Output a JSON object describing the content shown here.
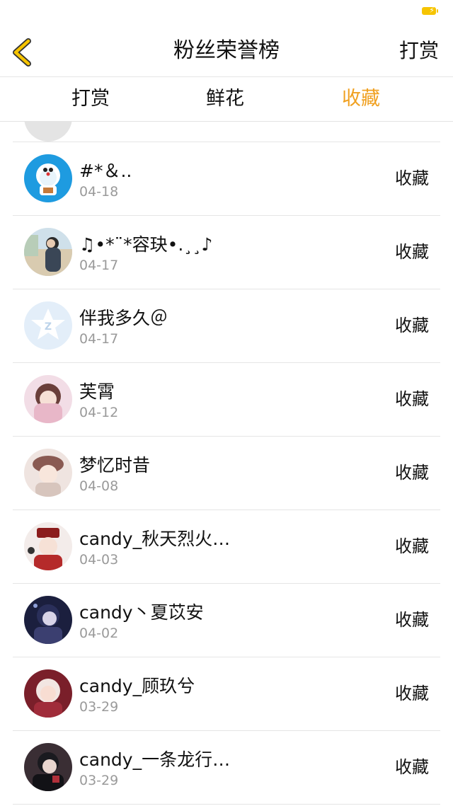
{
  "header": {
    "title": "粉丝荣誉榜",
    "action_label": "打赏"
  },
  "tabs": [
    {
      "label": "打赏"
    },
    {
      "label": "鲜花"
    },
    {
      "label": "收藏",
      "active": true
    }
  ],
  "colors": {
    "accent": "#f0a020",
    "back_icon": "#f6c400"
  },
  "fans": [
    {
      "name": "#*＆..",
      "date": "04-18",
      "action": "收藏",
      "avatar": "doraemon-avatar"
    },
    {
      "name": "♫•*¨*容玦•.¸¸♪",
      "date": "04-17",
      "action": "收藏",
      "avatar": "photo-avatar"
    },
    {
      "name": "伴我多久＠",
      "date": "04-17",
      "action": "收藏",
      "avatar": "qq-default-avatar"
    },
    {
      "name": "芙霄",
      "date": "04-12",
      "action": "收藏",
      "avatar": "anime-avatar"
    },
    {
      "name": "梦忆时昔",
      "date": "04-08",
      "action": "收藏",
      "avatar": "anime-avatar"
    },
    {
      "name": "candy_秋天烈火…",
      "date": "04-03",
      "action": "收藏",
      "avatar": "anime-avatar"
    },
    {
      "name": "candy丶夏苡安",
      "date": "04-02",
      "action": "收藏",
      "avatar": "anime-avatar"
    },
    {
      "name": "candy_顾玖兮",
      "date": "03-29",
      "action": "收藏",
      "avatar": "anime-avatar"
    },
    {
      "name": "candy_一条龙行…",
      "date": "03-29",
      "action": "收藏",
      "avatar": "anime-avatar"
    }
  ]
}
